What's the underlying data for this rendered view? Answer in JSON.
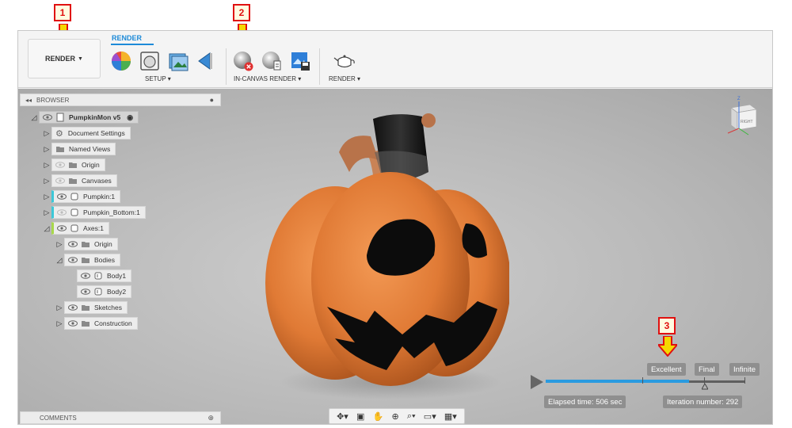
{
  "toolbar": {
    "workspace_label": "RENDER",
    "active_tab": "RENDER",
    "groups": {
      "setup": "SETUP",
      "in_canvas": "IN-CANVAS RENDER",
      "render": "RENDER"
    }
  },
  "browser": {
    "title": "BROWSER",
    "nodes": [
      {
        "label": "PumpkinMon v5"
      },
      {
        "label": "Document Settings"
      },
      {
        "label": "Named Views"
      },
      {
        "label": "Origin"
      },
      {
        "label": "Canvases"
      },
      {
        "label": "Pumpkin:1"
      },
      {
        "label": "Pumpkin_Bottom:1"
      },
      {
        "label": "Axes:1"
      },
      {
        "label": "Origin"
      },
      {
        "label": "Bodies"
      },
      {
        "label": "Body1"
      },
      {
        "label": "Body2"
      },
      {
        "label": "Sketches"
      },
      {
        "label": "Construction"
      }
    ]
  },
  "comments": {
    "title": "COMMENTS"
  },
  "render_progress": {
    "quality_levels": [
      "Excellent",
      "Final",
      "Infinite"
    ],
    "elapsed": "Elapsed time: 506 sec",
    "iteration": "Iteration number: 292",
    "progress_fraction": 0.72
  },
  "viewcube": {
    "face_label": "RIGHT",
    "axis_label": "Z"
  },
  "callouts": [
    "1",
    "2",
    "3"
  ],
  "colors": {
    "accent": "#1d8ad8",
    "callout_border": "#e01010",
    "arrow_fill": "#f5d800",
    "pumpkin": "#e8823c",
    "progress": "#2a9be0"
  }
}
